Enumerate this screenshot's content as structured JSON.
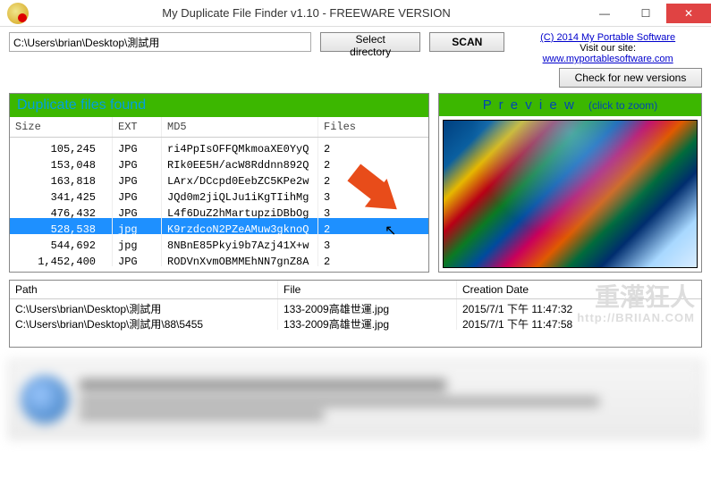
{
  "window": {
    "title": "My Duplicate File Finder v1.10 - FREEWARE VERSION"
  },
  "toolbar": {
    "path_value": "C:\\Users\\brian\\Desktop\\測試用",
    "select_dir_label": "Select directory",
    "scan_label": "SCAN"
  },
  "credits": {
    "copyright": "(C) 2014 My Portable Software",
    "visit_prefix": "Visit our site: ",
    "site_link": "www.myportablesoftware.com",
    "check_versions_label": "Check for new versions"
  },
  "dup_panel": {
    "header": "Duplicate files found",
    "columns": {
      "size": "Size",
      "ext": "EXT",
      "md5": "MD5",
      "files": "Files"
    },
    "rows": [
      {
        "size": "105,245",
        "ext": "JPG",
        "md5": "ri4PpIsOFFQMkmoaXE0YyQ",
        "files": "2",
        "selected": false
      },
      {
        "size": "153,048",
        "ext": "JPG",
        "md5": "RIk0EE5H/acW8Rddnn892Q",
        "files": "2",
        "selected": false
      },
      {
        "size": "163,818",
        "ext": "JPG",
        "md5": "LArx/DCcpd0EebZC5KPe2w",
        "files": "2",
        "selected": false
      },
      {
        "size": "341,425",
        "ext": "JPG",
        "md5": "JQd0m2jiQLJu1iKgTIihMg",
        "files": "3",
        "selected": false
      },
      {
        "size": "476,432",
        "ext": "JPG",
        "md5": "L4f6DuZ2hMartupziDBbOg",
        "files": "3",
        "selected": false
      },
      {
        "size": "528,538",
        "ext": "jpg",
        "md5": "K9rzdcoN2PZeAMuw3gknoQ",
        "files": "2",
        "selected": true
      },
      {
        "size": "544,692",
        "ext": "jpg",
        "md5": "8NBnE85Pkyi9b7Azj41X+w",
        "files": "3",
        "selected": false
      },
      {
        "size": "1,452,400",
        "ext": "JPG",
        "md5": "RODVnXvmOBMMEhNN7gnZ8A",
        "files": "2",
        "selected": false
      }
    ]
  },
  "preview": {
    "header": "P r e v i e w",
    "zoom_hint": "(click to zoom)"
  },
  "detail_panel": {
    "columns": {
      "path": "Path",
      "file": "File",
      "date": "Creation Date"
    },
    "rows": [
      {
        "path": "C:\\Users\\brian\\Desktop\\測試用",
        "file": "133-2009高雄世運.jpg",
        "date": "2015/7/1 下午 11:47:32"
      },
      {
        "path": "C:\\Users\\brian\\Desktop\\測試用\\88\\5455",
        "file": "133-2009高雄世運.jpg",
        "date": "2015/7/1 下午 11:47:58"
      }
    ]
  },
  "watermark": {
    "line1": "重灌狂人",
    "line2": "http://BRIIAN.COM"
  }
}
